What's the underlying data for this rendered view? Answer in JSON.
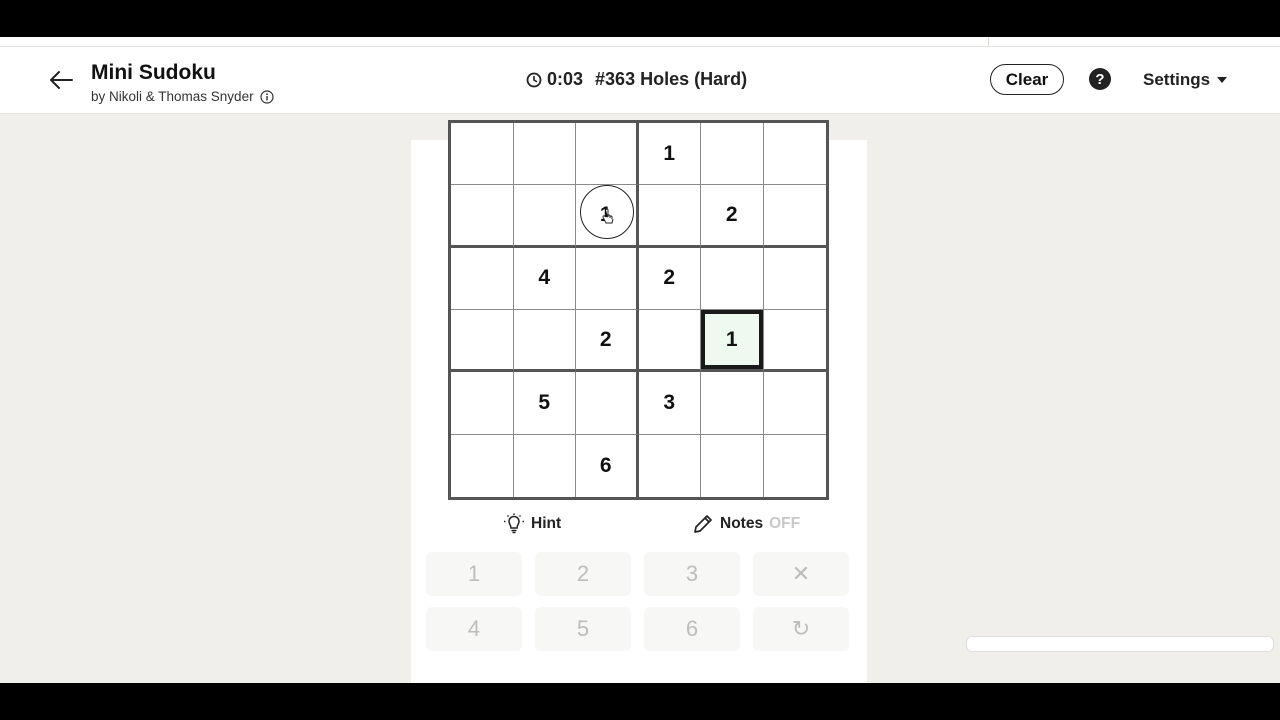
{
  "header": {
    "title": "Mini Sudoku",
    "byline": "by Nikoli & Thomas Snyder",
    "timer": "0:03",
    "puzzle": "#363 Holes (Hard)",
    "clear_label": "Clear",
    "help_label": "?",
    "settings_label": "Settings"
  },
  "grid": {
    "rows": [
      [
        "",
        "",
        "",
        "1",
        "",
        ""
      ],
      [
        "",
        "",
        "1",
        "",
        "2",
        ""
      ],
      [
        "",
        "4",
        "",
        "2",
        "",
        ""
      ],
      [
        "",
        "",
        "2",
        "",
        "1",
        ""
      ],
      [
        "",
        "5",
        "",
        "3",
        "",
        ""
      ],
      [
        "",
        "",
        "6",
        "",
        "",
        ""
      ]
    ],
    "selected": {
      "row": 3,
      "col": 4
    }
  },
  "controls": {
    "hint_label": "Hint",
    "notes_label": "Notes",
    "notes_state": "OFF"
  },
  "keypad": [
    "1",
    "2",
    "3",
    "✕",
    "4",
    "5",
    "6",
    "↻"
  ],
  "icons": [
    "back-arrow-icon",
    "info-icon",
    "clock-icon",
    "question-icon",
    "caret-down-icon",
    "lightbulb-icon",
    "pencil-icon",
    "close-icon",
    "undo-icon",
    "hand-cursor-icon"
  ]
}
